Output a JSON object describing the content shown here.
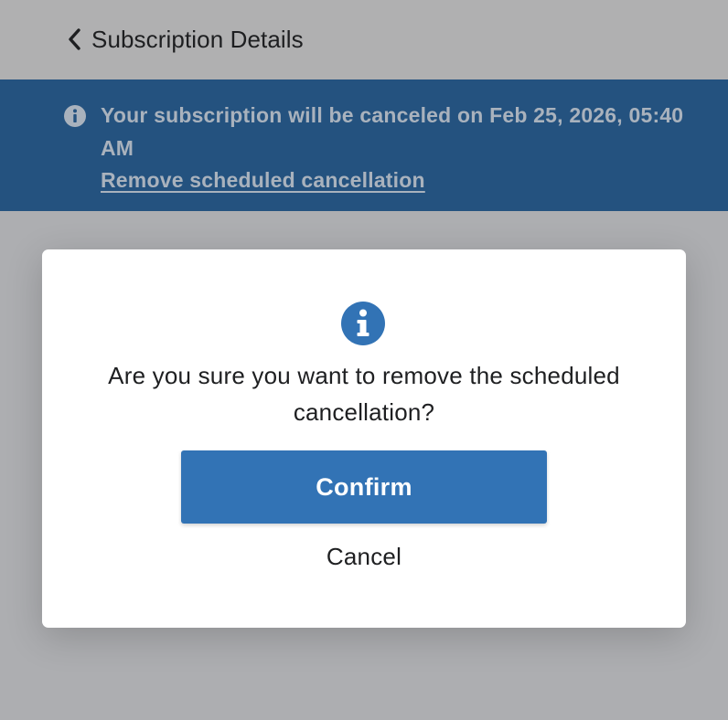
{
  "header": {
    "title": "Subscription Details",
    "back_icon": "chevron-left-icon"
  },
  "banner": {
    "icon": "info-icon",
    "message": "Your subscription will be canceled on Feb 25, 2026, 05:40 AM",
    "link_label": "Remove scheduled cancellation"
  },
  "modal": {
    "icon": "info-icon",
    "message": "Are you sure you want to remove the scheduled cancellation?",
    "confirm_label": "Confirm",
    "cancel_label": "Cancel"
  },
  "colors": {
    "overlay": "#adaeb1",
    "banner_background": "#24527f",
    "accent": "#3273b5",
    "modal_background": "#ffffff"
  }
}
